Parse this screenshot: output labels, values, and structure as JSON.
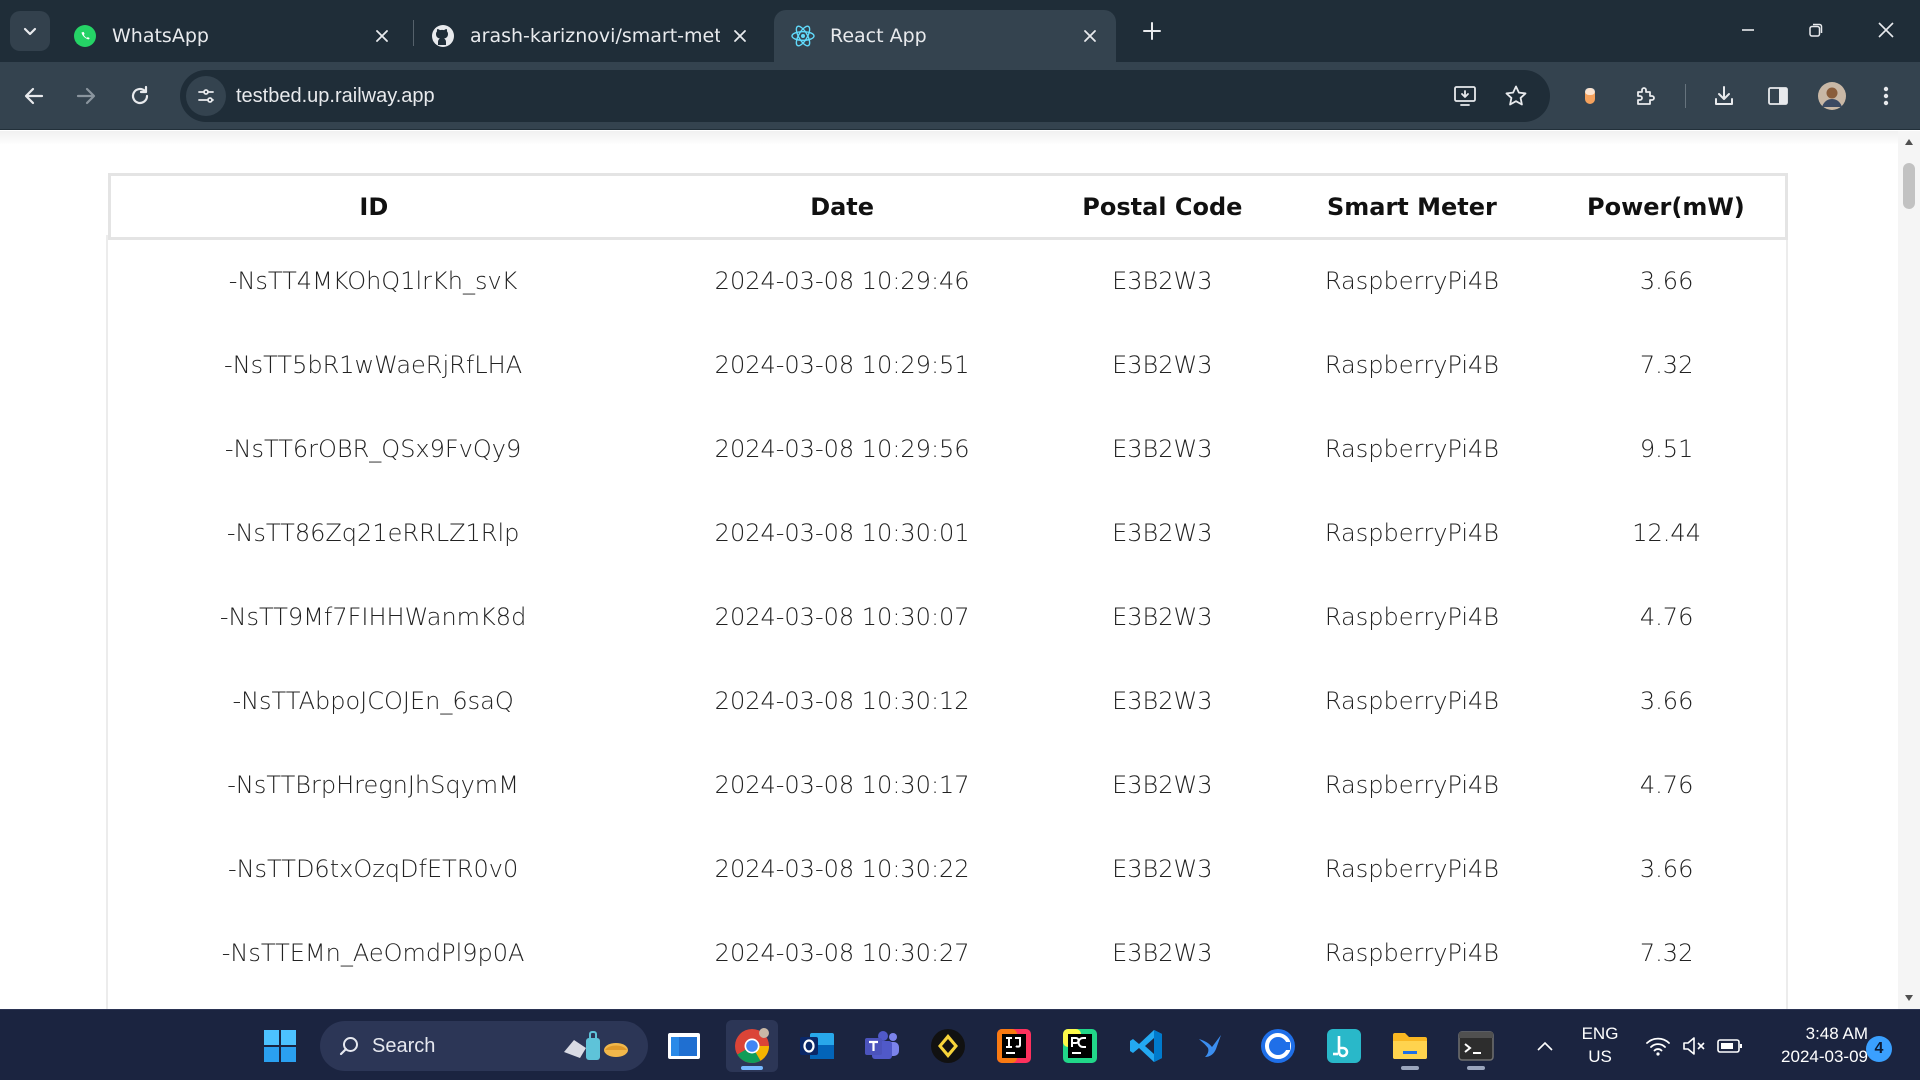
{
  "browser": {
    "tabs": [
      {
        "title": "WhatsApp",
        "icon": "whatsapp-icon",
        "active": false
      },
      {
        "title": "arash-kariznovi/smart-metering",
        "icon": "github-icon",
        "active": false
      },
      {
        "title": "React App",
        "icon": "react-icon",
        "active": true
      }
    ],
    "url": "testbed.up.railway.app"
  },
  "table": {
    "columns": [
      "ID",
      "Date",
      "Postal Code",
      "Smart Meter",
      "Power(mW)"
    ],
    "rows": [
      [
        "-NsTT4MKOhQ1lrKh_svK",
        "2024-03-08 10:29:46",
        "E3B2W3",
        "RaspberryPi4B",
        "3.66"
      ],
      [
        "-NsTT5bR1wWaeRjRfLHA",
        "2024-03-08 10:29:51",
        "E3B2W3",
        "RaspberryPi4B",
        "7.32"
      ],
      [
        "-NsTT6rOBR_QSx9FvQy9",
        "2024-03-08 10:29:56",
        "E3B2W3",
        "RaspberryPi4B",
        "9.51"
      ],
      [
        "-NsTT86Zq21eRRLZ1Rlp",
        "2024-03-08 10:30:01",
        "E3B2W3",
        "RaspberryPi4B",
        "12.44"
      ],
      [
        "-NsTT9Mf7FIHHWanmK8d",
        "2024-03-08 10:30:07",
        "E3B2W3",
        "RaspberryPi4B",
        "4.76"
      ],
      [
        "-NsTTAbpoJCOJEn_6saQ",
        "2024-03-08 10:30:12",
        "E3B2W3",
        "RaspberryPi4B",
        "3.66"
      ],
      [
        "-NsTTBrpHregnJhSqymM",
        "2024-03-08 10:30:17",
        "E3B2W3",
        "RaspberryPi4B",
        "4.76"
      ],
      [
        "-NsTTD6txOzqDfETR0v0",
        "2024-03-08 10:30:22",
        "E3B2W3",
        "RaspberryPi4B",
        "3.66"
      ],
      [
        "-NsTTEMn_AeOmdPl9p0A",
        "2024-03-08 10:30:27",
        "E3B2W3",
        "RaspberryPi4B",
        "7.32"
      ]
    ]
  },
  "taskbar": {
    "search_label": "Search",
    "language": "ENG",
    "region": "US",
    "time": "3:48 AM",
    "date": "2024-03-09",
    "notifications": "4"
  },
  "colors": {
    "chrome_frame": "#1f2d38",
    "chrome_toolbar": "#34434f",
    "taskbar": "#1b2440",
    "accent": "#76b9ff"
  }
}
